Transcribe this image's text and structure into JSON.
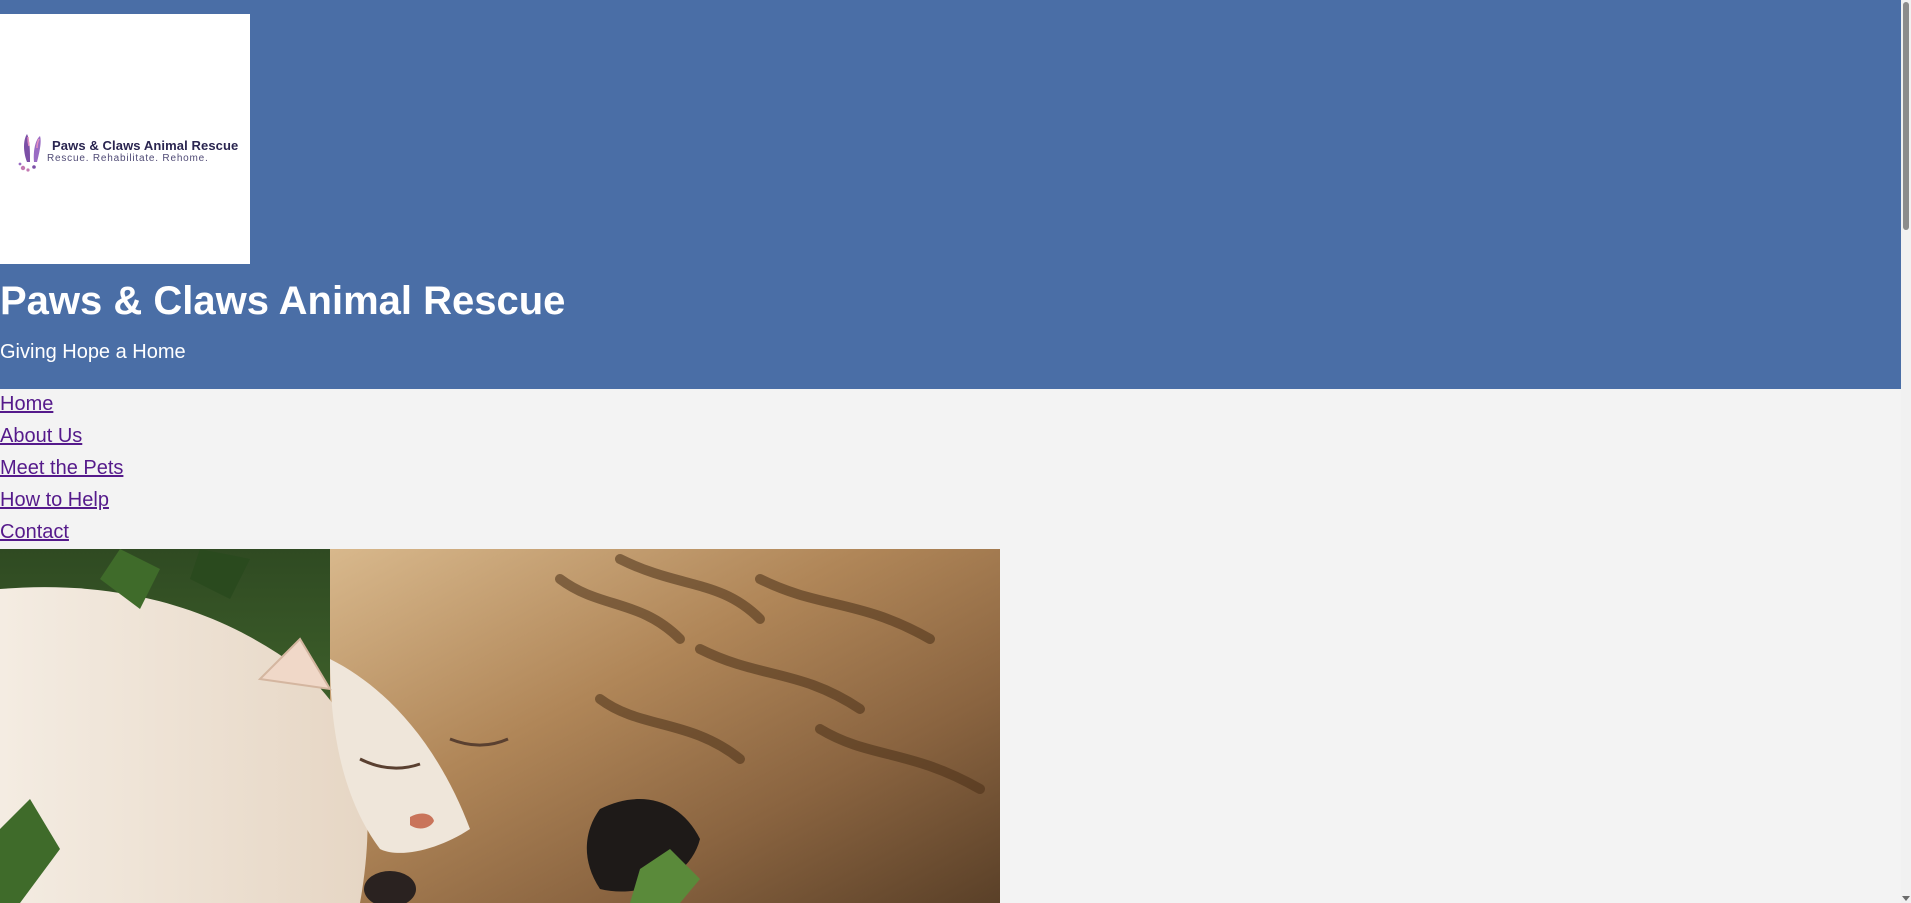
{
  "site": {
    "title": "Paws & Claws Animal Rescue",
    "tagline": "Giving Hope a Home"
  },
  "logo": {
    "name": "Paws & Claws Animal Rescue",
    "tagline": "Rescue. Rehabilitate. Rehome.",
    "icon": "bunny-ears-paw-icon"
  },
  "nav": {
    "items": [
      {
        "label": "Home"
      },
      {
        "label": "About Us"
      },
      {
        "label": "Meet the Pets"
      },
      {
        "label": "How to Help"
      },
      {
        "label": "Contact"
      }
    ]
  },
  "hero": {
    "image": "cat-and-dog-cuddling-photo"
  },
  "colors": {
    "header_bg": "#4a6ea6",
    "page_bg": "#f3f3f3",
    "link": "#551a8b",
    "header_text": "#ffffff"
  }
}
